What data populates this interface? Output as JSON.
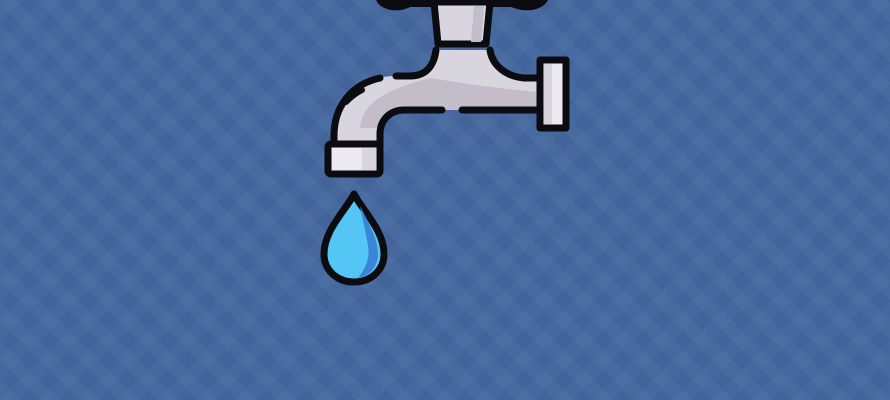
{
  "scene": {
    "background_color": "#44689f",
    "icons": [
      "water-faucet-icon",
      "water-drop-icon"
    ],
    "colors": {
      "faucet_body": "#d9d5de",
      "faucet_shade": "#c2bdc9",
      "faucet_highlight": "#eceaf0",
      "outline": "#0b0b10",
      "drop_fill": "#53c6f5",
      "drop_shade": "#3a86d6"
    }
  }
}
